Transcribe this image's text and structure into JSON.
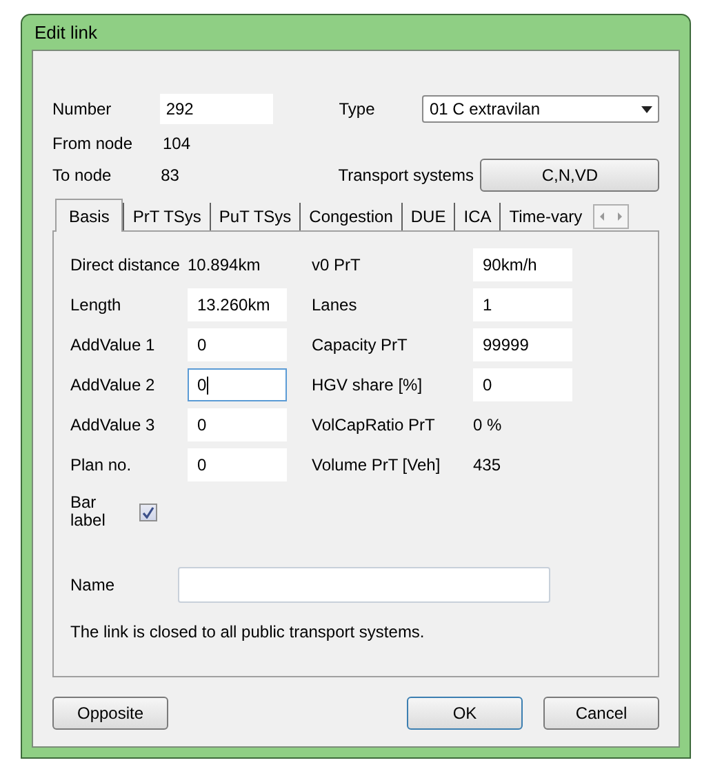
{
  "window": {
    "title": "Edit link"
  },
  "header": {
    "number": {
      "label": "Number",
      "value": "292"
    },
    "type": {
      "label": "Type",
      "value": "01 C extravilan"
    },
    "from_node": {
      "label": "From node",
      "value": "104"
    },
    "to_node": {
      "label": "To node",
      "value": "83"
    },
    "transport_systems": {
      "label": "Transport systems",
      "button": "C,N,VD"
    }
  },
  "tabs": [
    {
      "label": "Basis",
      "selected": true
    },
    {
      "label": "PrT TSys",
      "selected": false
    },
    {
      "label": "PuT TSys",
      "selected": false
    },
    {
      "label": "Congestion",
      "selected": false
    },
    {
      "label": "DUE",
      "selected": false
    },
    {
      "label": "ICA",
      "selected": false
    },
    {
      "label": "Time-vary",
      "selected": false
    }
  ],
  "rows": [
    {
      "left": {
        "kind": "text",
        "label": "Direct distance",
        "value": "10.894km"
      },
      "right": {
        "kind": "field",
        "label": "v0 PrT",
        "value": "90km/h",
        "focused": false
      }
    },
    {
      "left": {
        "kind": "field",
        "label": "Length",
        "value": "13.260km",
        "focused": false
      },
      "right": {
        "kind": "field",
        "label": "Lanes",
        "value": "1",
        "focused": false
      }
    },
    {
      "left": {
        "kind": "field",
        "label": "AddValue 1",
        "value": "0",
        "focused": false
      },
      "right": {
        "kind": "field",
        "label": "Capacity PrT",
        "value": "99999",
        "focused": false
      }
    },
    {
      "left": {
        "kind": "field",
        "label": "AddValue 2",
        "value": "0",
        "focused": true
      },
      "right": {
        "kind": "field",
        "label": "HGV share [%]",
        "value": "0",
        "focused": false
      }
    },
    {
      "left": {
        "kind": "field",
        "label": "AddValue 3",
        "value": "0",
        "focused": false
      },
      "right": {
        "kind": "text",
        "label": "VolCapRatio PrT",
        "value": "0 %"
      }
    },
    {
      "left": {
        "kind": "field",
        "label": "Plan no.",
        "value": "0",
        "focused": false
      },
      "right": {
        "kind": "text",
        "label": "Volume PrT [Veh]",
        "value": "435"
      }
    }
  ],
  "bar_label": {
    "label": "Bar label",
    "checked": true
  },
  "name": {
    "label": "Name"
  },
  "note": "The link is closed to all public transport systems.",
  "buttons": [
    {
      "label": "Opposite",
      "default": false
    },
    {
      "label": "OK",
      "default": true
    },
    {
      "label": "Cancel",
      "default": false
    }
  ]
}
